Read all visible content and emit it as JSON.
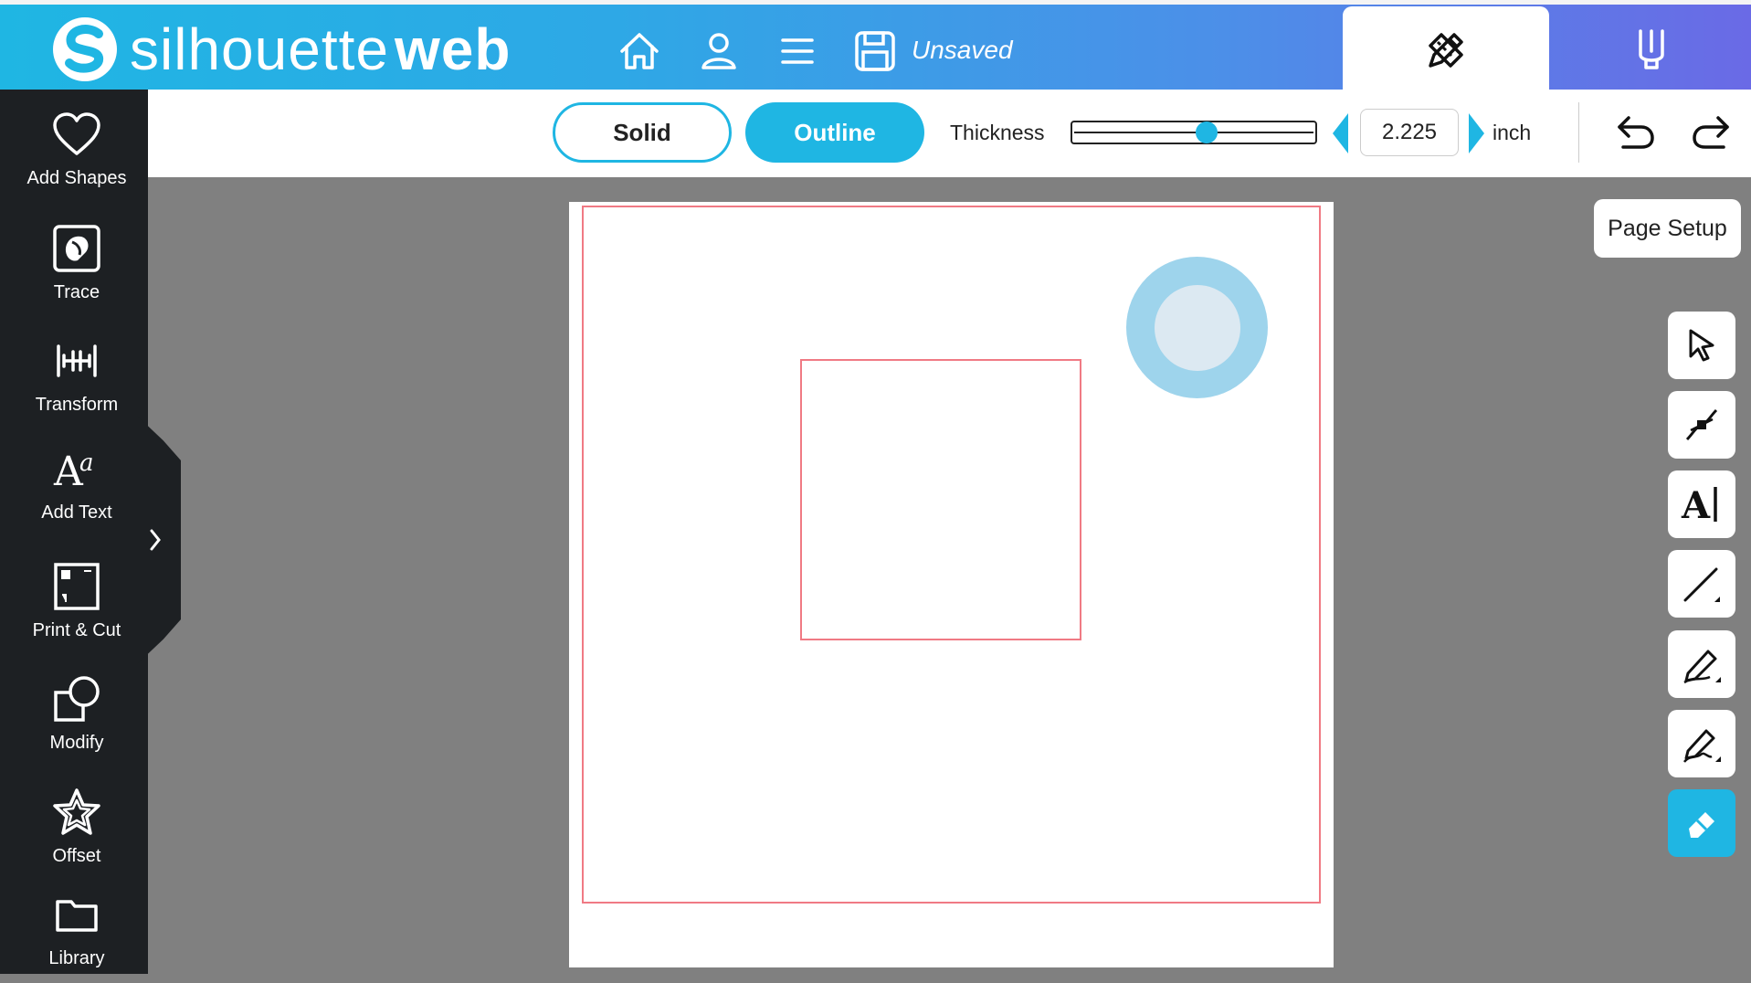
{
  "header": {
    "logo_text_light": "silhouette",
    "logo_text_bold": "web",
    "save_status": "Unsaved",
    "icons": [
      "home-icon",
      "user-icon",
      "menu-icon",
      "save-icon",
      "design-tab-icon",
      "send-tab-icon"
    ]
  },
  "toolbar": {
    "solid_label": "Solid",
    "outline_label": "Outline",
    "selected": "Outline",
    "thickness_label": "Thickness",
    "thickness_value": "2.225",
    "slider_fraction": 0.55,
    "unit_label": "inch"
  },
  "sidebar": {
    "items": [
      {
        "label": "Add Shapes",
        "icon": "heart-icon"
      },
      {
        "label": "Trace",
        "icon": "trace-icon"
      },
      {
        "label": "Transform",
        "icon": "transform-icon"
      },
      {
        "label": "Add Text",
        "icon": "text-icon"
      },
      {
        "label": "Print & Cut",
        "icon": "print-cut-icon"
      },
      {
        "label": "Modify",
        "icon": "modify-icon"
      },
      {
        "label": "Offset",
        "icon": "star-icon"
      },
      {
        "label": "Library",
        "icon": "folder-icon"
      }
    ]
  },
  "right_panel": {
    "page_setup_label": "Page Setup",
    "tools": [
      "select",
      "point-edit",
      "text",
      "line",
      "draw",
      "polyline",
      "eraser"
    ],
    "active_tool": "eraser"
  },
  "colors": {
    "accent": "#1fb6e3",
    "sidebar_bg": "#1d2023",
    "canvas_bg": "#808080",
    "cut_line": "#f07a84",
    "ring_outer": "#9ed4ec",
    "ring_inner": "#dce9f2"
  }
}
